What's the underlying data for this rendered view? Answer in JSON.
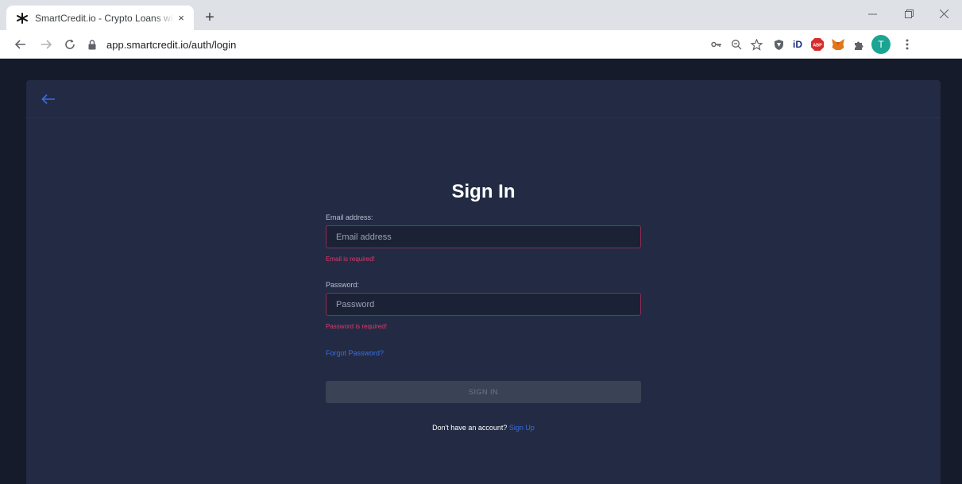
{
  "browser": {
    "tab_title": "SmartCredit.io - Crypto Loans wi",
    "tab_close": "×",
    "new_tab": "+",
    "url": "app.smartcredit.io/auth/login",
    "profile_initial": "T",
    "ext_abp": "ABP",
    "ext_id": "iD"
  },
  "page": {
    "heading": "Sign In",
    "email_label": "Email address:",
    "email_placeholder": "Email address",
    "email_value": "",
    "email_error": "Email is required!",
    "password_label": "Password:",
    "password_placeholder": "Password",
    "password_value": "",
    "password_error": "Password is required!",
    "forgot_link": "Forgot Password?",
    "signin_button": "SIGN IN",
    "no_account_text": "Don't have an account? ",
    "signup_link": "Sign Up"
  },
  "colors": {
    "page_bg": "#161b2c",
    "card_bg": "#222b43",
    "error": "#e2386b",
    "link": "#3b6ce6",
    "input_border": "#8c2c55"
  },
  "icons": [
    "favicon-icon",
    "close-icon",
    "plus-icon",
    "minimize-icon",
    "maximize-icon",
    "window-close-icon",
    "back-arrow-icon",
    "forward-arrow-icon",
    "reload-icon",
    "lock-icon",
    "key-icon",
    "zoom-icon",
    "star-icon",
    "shield-icon",
    "id-icon",
    "adblock-icon",
    "fox-icon",
    "puzzle-icon",
    "avatar",
    "menu-icon",
    "back-arrow-page-icon"
  ]
}
